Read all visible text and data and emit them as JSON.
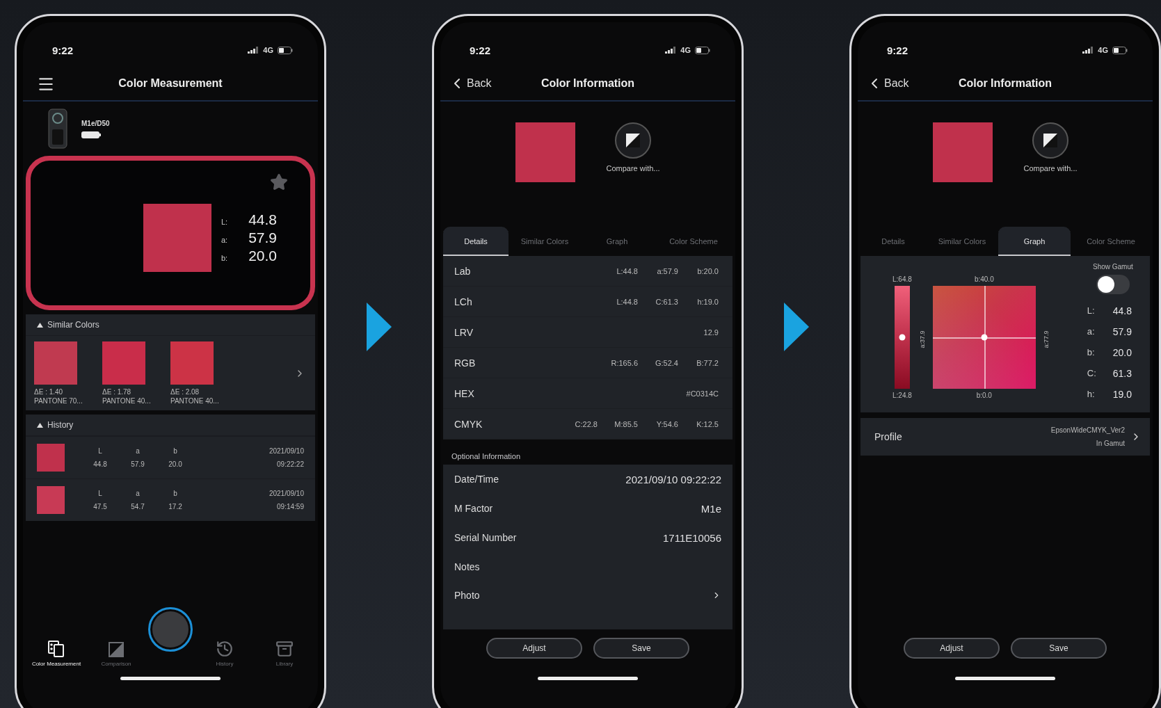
{
  "screens": [
    {
      "kind": "measurement",
      "status": {
        "time": "9:22",
        "network": "4G"
      },
      "header": {
        "title": "Color Measurement"
      },
      "device": {
        "name": "M1e/D50"
      },
      "measurement": {
        "color": "#c0314c",
        "values": [
          {
            "label": "L:",
            "value": "44.8"
          },
          {
            "label": "a:",
            "value": "57.9"
          },
          {
            "label": "b:",
            "value": "20.0"
          }
        ]
      },
      "similar_colors": {
        "title": "Similar Colors",
        "items": [
          {
            "delta": "ΔE : 1.40",
            "name": "PANTONE 70...",
            "color": "#c03a50"
          },
          {
            "delta": "ΔE : 1.78",
            "name": "PANTONE 40...",
            "color": "#c92d4a"
          },
          {
            "delta": "ΔE : 2.08",
            "name": "PANTONE 40...",
            "color": "#cc3346"
          }
        ]
      },
      "history": {
        "title": "History",
        "rows": [
          {
            "color": "#c0314c",
            "columns": [
              {
                "label": "L",
                "value": "44.8"
              },
              {
                "label": "a",
                "value": "57.9"
              },
              {
                "label": "b",
                "value": "20.0"
              }
            ],
            "date": "2021/09/10",
            "time": "09:22:22"
          },
          {
            "color": "#c83a55",
            "columns": [
              {
                "label": "L",
                "value": "47.5"
              },
              {
                "label": "a",
                "value": "54.7"
              },
              {
                "label": "b",
                "value": "17.2"
              }
            ],
            "date": "2021/09/10",
            "time": "09:14:59"
          }
        ]
      },
      "nav": [
        {
          "kind": "measure",
          "label": "Color Measurement",
          "selected": true
        },
        {
          "kind": "compare",
          "label": "Comparison",
          "selected": false
        },
        {
          "kind": "shutter"
        },
        {
          "kind": "history",
          "label": "History",
          "selected": false
        },
        {
          "kind": "library",
          "label": "Library",
          "selected": false
        }
      ]
    },
    {
      "kind": "info",
      "status": {
        "time": "9:22",
        "network": "4G"
      },
      "header": {
        "back": "Back",
        "title": "Color Information"
      },
      "swatch": {
        "color": "#c0314c"
      },
      "compare": "Compare with...",
      "tabs": [
        {
          "label": "Details",
          "selected": true
        },
        {
          "label": "Similar Colors",
          "selected": false
        },
        {
          "label": "Graph",
          "selected": false
        },
        {
          "label": "Color Scheme",
          "selected": false
        }
      ],
      "panel": {
        "kind": "details",
        "rows": [
          {
            "label": "Lab",
            "values": [
              "L:44.8",
              "a:57.9",
              "b:20.0"
            ]
          },
          {
            "label": "LCh",
            "values": [
              "L:44.8",
              "C:61.3",
              "h:19.0"
            ]
          },
          {
            "label": "LRV",
            "values": [
              "12.9"
            ]
          },
          {
            "label": "RGB",
            "values": [
              "R:165.6",
              "G:52.4",
              "B:77.2"
            ]
          },
          {
            "label": "HEX",
            "values": [
              "#C0314C"
            ]
          },
          {
            "label": "CMYK",
            "values": [
              "C:22.8",
              "M:85.5",
              "Y:54.6",
              "K:12.5"
            ]
          }
        ],
        "optional": {
          "title": "Optional Information",
          "rows": [
            {
              "kind": "field",
              "label": "Date/Time",
              "value": "2021/09/10 09:22:22"
            },
            {
              "kind": "field",
              "label": "M Factor",
              "value": "M1e"
            },
            {
              "kind": "field",
              "label": "Serial Number",
              "value": "1711E10056"
            },
            {
              "kind": "field",
              "label": "Notes"
            },
            {
              "kind": "link",
              "label": "Photo"
            }
          ]
        }
      },
      "buttons": [
        "Adjust",
        "Save"
      ]
    },
    {
      "kind": "info",
      "status": {
        "time": "9:22",
        "network": "4G"
      },
      "header": {
        "back": "Back",
        "title": "Color Information"
      },
      "swatch": {
        "color": "#c0314c"
      },
      "compare": "Compare with...",
      "tabs": [
        {
          "label": "Details",
          "selected": false
        },
        {
          "label": "Similar Colors",
          "selected": false
        },
        {
          "label": "Graph",
          "selected": true
        },
        {
          "label": "Color Scheme",
          "selected": false
        }
      ],
      "panel": {
        "kind": "graph",
        "lightness": {
          "top": "L:64.8",
          "bottom": "L:24.8",
          "level": 0.5
        },
        "plane": {
          "top": "b:40.0",
          "bottom": "b:0.0",
          "left": "a:37.9",
          "right": "a:77.9"
        },
        "gamut": {
          "label": "Show Gamut",
          "on": false
        },
        "values": [
          {
            "label": "L:",
            "value": "44.8"
          },
          {
            "label": "a:",
            "value": "57.9"
          },
          {
            "label": "b:",
            "value": "20.0"
          },
          {
            "label": "C:",
            "value": "61.3"
          },
          {
            "label": "h:",
            "value": "19.0"
          }
        ],
        "profile": {
          "label": "Profile",
          "value": "EpsonWideCMYK_Ver2",
          "status": "In Gamut"
        }
      },
      "buttons": [
        "Adjust",
        "Save"
      ]
    }
  ]
}
